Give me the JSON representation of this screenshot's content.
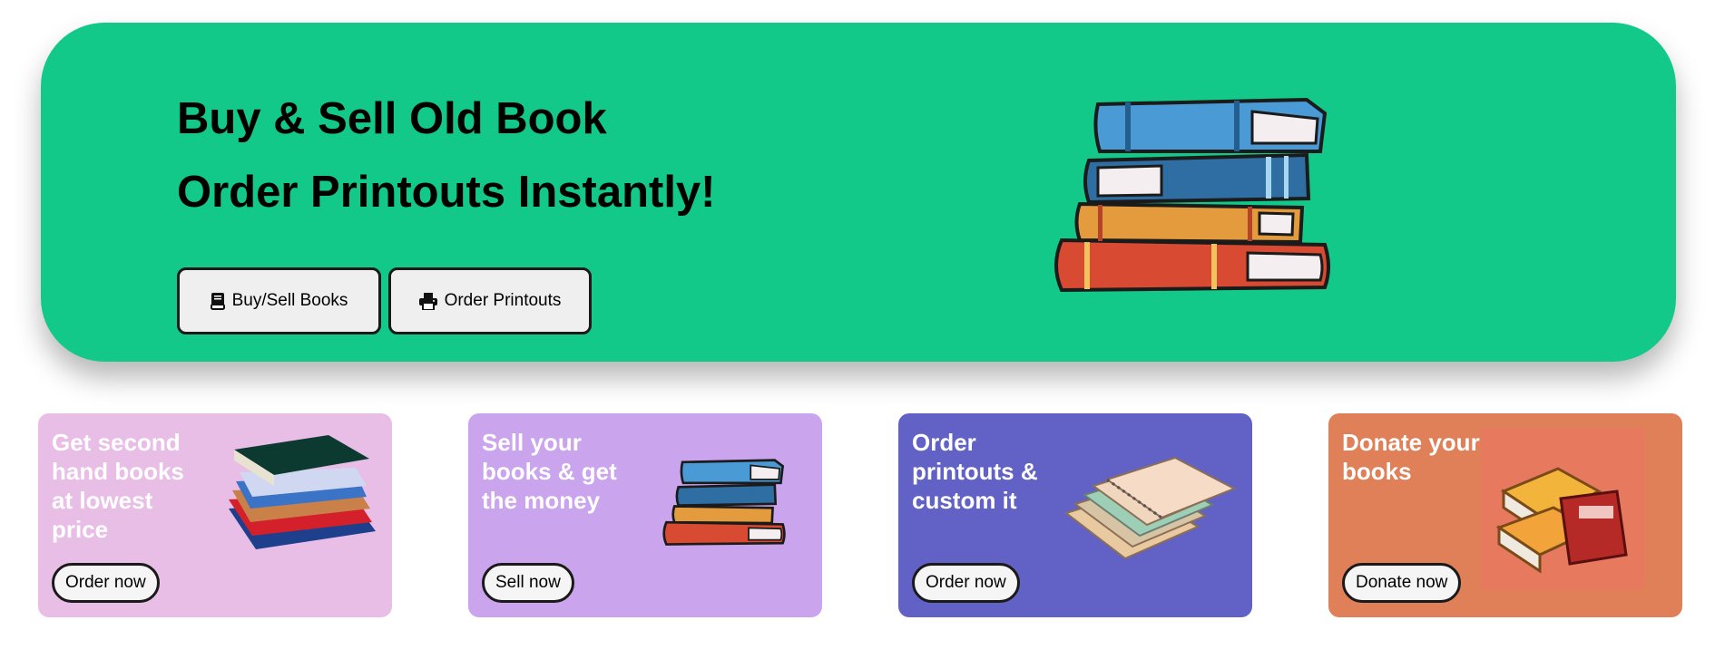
{
  "hero": {
    "title_line1": "Buy & Sell Old Book",
    "title_line2": "Order Printouts Instantly!",
    "buttons": [
      {
        "label": "Buy/Sell Books",
        "icon": "book-icon"
      },
      {
        "label": "Order Printouts",
        "icon": "printer-icon"
      }
    ],
    "image": "stacked-books-illustration"
  },
  "cards": [
    {
      "text": "Get second hand books at lowest price",
      "button": "Order now",
      "color": "#e8bde6",
      "image": "book-stack-photo"
    },
    {
      "text": "Sell your books & get the money",
      "button": "Sell now",
      "color": "#cba4ee",
      "image": "stacked-books-illustration"
    },
    {
      "text": "Order printouts & custom it",
      "button": "Order now",
      "color": "#6262c6",
      "image": "notebooks-illustration"
    },
    {
      "text": "Donate your books",
      "button": "Donate now",
      "color": "#e08058",
      "image": "donated-books-illustration"
    }
  ],
  "colors": {
    "hero_background": "#12c989",
    "card_text": "#ffffff"
  }
}
